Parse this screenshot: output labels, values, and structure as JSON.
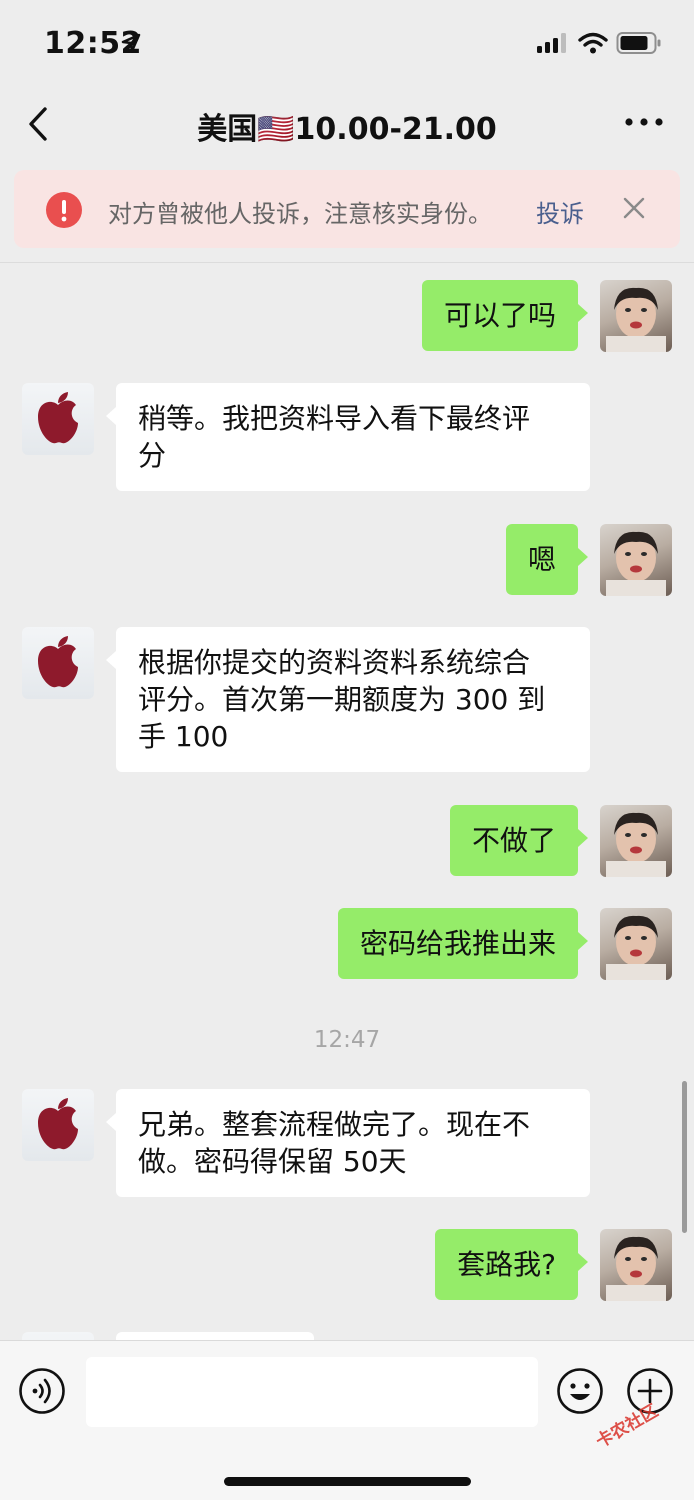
{
  "status_bar": {
    "time": "12:52",
    "location_icon": "location-arrow-icon",
    "signal_icon": "cellular-signal-icon",
    "wifi_icon": "wifi-icon",
    "battery_icon": "battery-icon"
  },
  "nav": {
    "title": "美国🇺🇸10.00-21.00",
    "back_icon": "chevron-left-icon",
    "more_icon": "more-dots-icon"
  },
  "warning": {
    "icon": "exclamation-circle-icon",
    "text": "对方曾被他人投诉，注意核实身份。",
    "action": "投诉",
    "close_icon": "close-icon",
    "color": "#e94f4f"
  },
  "messages": [
    {
      "side": "out",
      "text": "可以了吗"
    },
    {
      "side": "in",
      "text": "稍等。我把资料导入看下最终评\n分"
    },
    {
      "side": "out",
      "text": "嗯"
    },
    {
      "side": "in",
      "text": "根据你提交的资料资料系统综合\n评分。首次第一期额度为 300 到\n手 100"
    },
    {
      "side": "out",
      "text": "不做了"
    },
    {
      "side": "out",
      "text": "密码给我推出来"
    },
    {
      "side": "in",
      "text": "兄弟。整套流程做完了。现在不\n做。密码得保留 50天"
    },
    {
      "side": "out",
      "text": "套路我?"
    }
  ],
  "timestamp": "12:47",
  "input_bar": {
    "voice_icon": "voice-icon",
    "emoji_icon": "emoji-icon",
    "plus_icon": "plus-circle-icon",
    "placeholder": ""
  },
  "watermark": "卡农社区",
  "colors": {
    "bubble_out": "#95ec69",
    "bubble_in": "#ffffff",
    "background": "#ededed",
    "link": "#4a5f8e"
  }
}
